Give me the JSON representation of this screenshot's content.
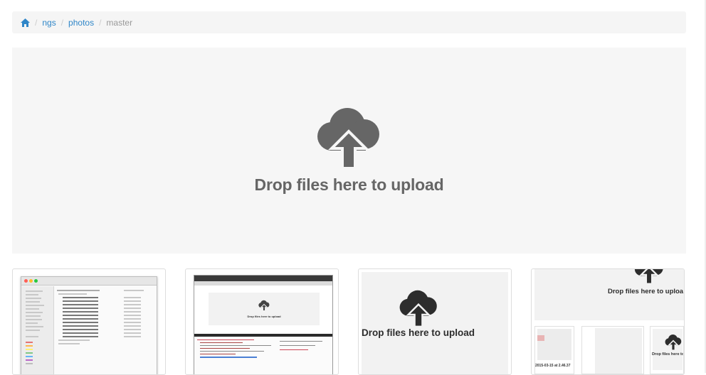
{
  "breadcrumb": {
    "home_icon": "home-icon",
    "items": [
      {
        "label": "ngs"
      },
      {
        "label": "photos"
      }
    ],
    "active": "master"
  },
  "dropzone": {
    "icon": "cloud-upload-icon",
    "text": "Drop files here to upload"
  },
  "thumbnails": [
    {
      "kind": "finder-window"
    },
    {
      "kind": "browser-window",
      "inner_text": "Drop files here to upload"
    },
    {
      "kind": "dropzone-screenshot",
      "inner_text": "Drop files here to upload"
    },
    {
      "kind": "gallery-screenshot",
      "inner_text": "Drop files here to uploa",
      "small_text": "Drop files here to",
      "caption": "2015-03-15 at 2.46.37"
    }
  ],
  "colors": {
    "link": "#2f86c8",
    "breadcrumb_bg": "#f5f5f5",
    "dropzone_bg": "#f6f6f6",
    "icon": "#666666"
  }
}
